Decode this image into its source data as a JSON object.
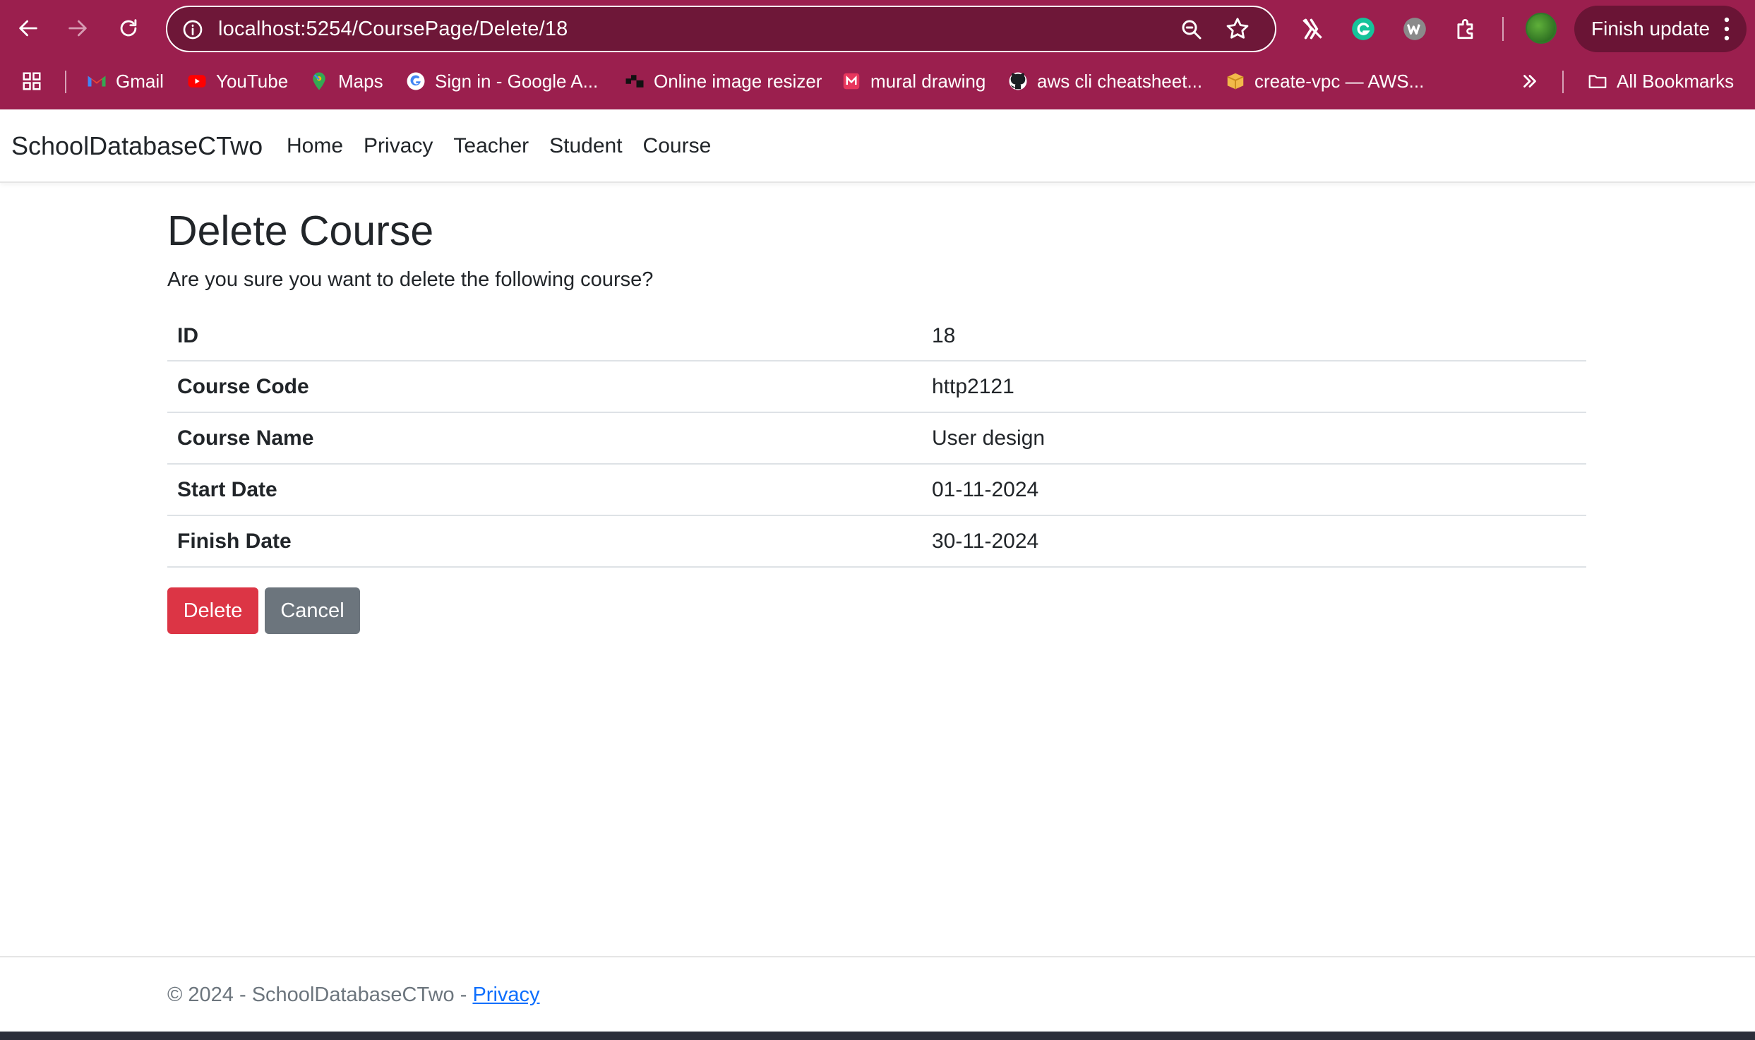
{
  "browser": {
    "url": "localhost:5254/CoursePage/Delete/18",
    "finish_update_label": "Finish update",
    "bookmarks": [
      {
        "label": "Gmail",
        "icon": "gmail-icon"
      },
      {
        "label": "YouTube",
        "icon": "youtube-icon"
      },
      {
        "label": "Maps",
        "icon": "maps-icon"
      },
      {
        "label": "Sign in - Google A...",
        "icon": "google-icon"
      },
      {
        "label": "Online image resizer",
        "icon": "resizer-icon"
      },
      {
        "label": "mural drawing",
        "icon": "mural-icon"
      },
      {
        "label": "aws cli cheatsheet...",
        "icon": "github-icon"
      },
      {
        "label": "create-vpc — AWS...",
        "icon": "aws-box-icon"
      }
    ],
    "all_bookmarks_label": "All Bookmarks",
    "colors": {
      "frame": "#9b1f4e",
      "omnibox": "#6e1738"
    }
  },
  "site": {
    "brand": "SchoolDatabaseCTwo",
    "nav": [
      "Home",
      "Privacy",
      "Teacher",
      "Student",
      "Course"
    ]
  },
  "content": {
    "title": "Delete Course",
    "question": "Are you sure you want to delete the following course?",
    "fields": [
      {
        "label": "ID",
        "value": "18"
      },
      {
        "label": "Course Code",
        "value": "http2121"
      },
      {
        "label": "Course Name",
        "value": "User design"
      },
      {
        "label": "Start Date",
        "value": "01-11-2024"
      },
      {
        "label": "Finish Date",
        "value": "30-11-2024"
      }
    ],
    "delete_label": "Delete",
    "cancel_label": "Cancel",
    "colors": {
      "danger": "#dc3545",
      "secondary": "#6c757d"
    }
  },
  "footer": {
    "text": "© 2024 - SchoolDatabaseCTwo - ",
    "link": "Privacy"
  }
}
